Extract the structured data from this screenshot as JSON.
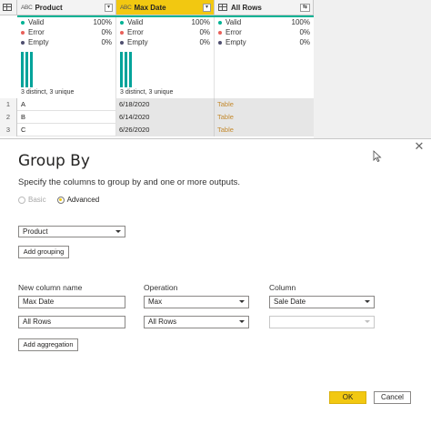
{
  "grid": {
    "columns": [
      {
        "type_icon": "ABC",
        "title": "Product",
        "selected": false
      },
      {
        "type_icon": "ABC",
        "title": "Max Date",
        "selected": true
      },
      {
        "type_icon": "table-icon",
        "title": "All Rows",
        "selected": false
      }
    ],
    "profiles": [
      {
        "valid": "Valid",
        "valid_pct": "100%",
        "error": "Error",
        "error_pct": "0%",
        "empty": "Empty",
        "empty_pct": "0%",
        "distinct": "3 distinct, 3 unique",
        "bars": 3
      },
      {
        "valid": "Valid",
        "valid_pct": "100%",
        "error": "Error",
        "error_pct": "0%",
        "empty": "Empty",
        "empty_pct": "0%",
        "distinct": "3 distinct, 3 unique",
        "bars": 1
      },
      {
        "valid": "Valid",
        "valid_pct": "100%",
        "error": "Error",
        "error_pct": "0%",
        "empty": "Empty",
        "empty_pct": "0%",
        "distinct": "",
        "bars": 0
      }
    ],
    "rows": [
      {
        "num": "1",
        "product": "A",
        "max_date": "6/18/2020",
        "all_rows": "Table"
      },
      {
        "num": "2",
        "product": "B",
        "max_date": "6/14/2020",
        "all_rows": "Table"
      },
      {
        "num": "3",
        "product": "C",
        "max_date": "6/26/2020",
        "all_rows": "Table"
      }
    ],
    "colors": {
      "valid": "#00b294",
      "error": "#e8605a",
      "empty": "#4f4f6f",
      "accent": "#f2c811"
    }
  },
  "dialog": {
    "title": "Group By",
    "subtitle": "Specify the columns to group by and one or more outputs.",
    "basic_label": "Basic",
    "advanced_label": "Advanced",
    "mode": "Advanced",
    "grouping_value": "Product",
    "add_grouping_label": "Add grouping",
    "headers": {
      "new_column": "New column name",
      "operation": "Operation",
      "column": "Column"
    },
    "aggregations": [
      {
        "name": "Max Date",
        "operation": "Max",
        "column": "Sale Date"
      },
      {
        "name": "All Rows",
        "operation": "All Rows",
        "column": ""
      }
    ],
    "add_aggregation_label": "Add aggregation",
    "ok_label": "OK",
    "cancel_label": "Cancel"
  }
}
